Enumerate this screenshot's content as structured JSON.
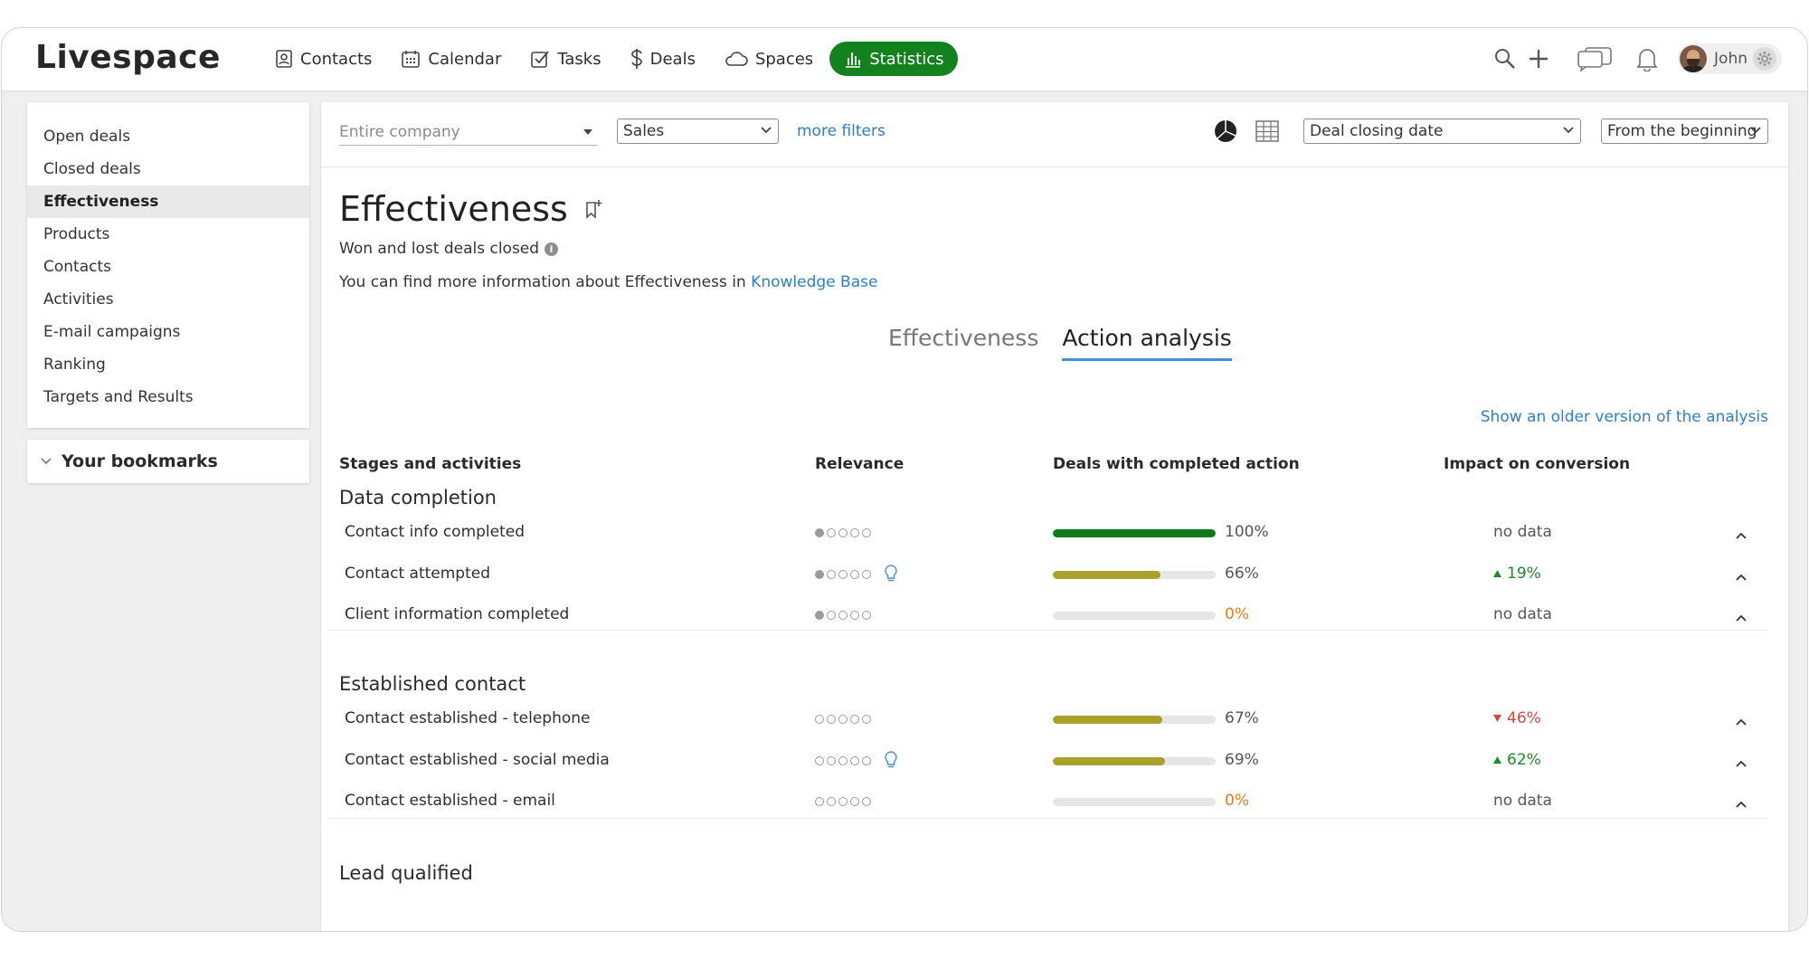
{
  "app": {
    "logo": "Livespace"
  },
  "nav": [
    {
      "label": "Contacts",
      "icon": "contacts-icon"
    },
    {
      "label": "Calendar",
      "icon": "calendar-icon"
    },
    {
      "label": "Tasks",
      "icon": "tasks-icon"
    },
    {
      "label": "Deals",
      "icon": "dollar-icon"
    },
    {
      "label": "Spaces",
      "icon": "cloud-icon"
    },
    {
      "label": "Statistics",
      "icon": "bar-chart-icon",
      "active": true
    }
  ],
  "user": {
    "name": "John"
  },
  "sidebar": {
    "items": [
      {
        "label": "Open deals"
      },
      {
        "label": "Closed deals"
      },
      {
        "label": "Effectiveness",
        "active": true
      },
      {
        "label": "Products"
      },
      {
        "label": "Contacts"
      },
      {
        "label": "Activities"
      },
      {
        "label": "E-mail campaigns"
      },
      {
        "label": "Ranking"
      },
      {
        "label": "Targets and Results"
      }
    ],
    "bookmarks_label": "Your bookmarks"
  },
  "filters": {
    "scope": "Entire company",
    "pipeline": "Sales",
    "more_filters": "more filters",
    "date_field": "Deal closing date",
    "period": "From the beginning"
  },
  "page": {
    "title": "Effectiveness",
    "subtitle": "Won and lost deals closed",
    "info_prefix": "You can find more information about Effectiveness in ",
    "info_link": "Knowledge Base",
    "tabs": [
      {
        "label": "Effectiveness",
        "active": false
      },
      {
        "label": "Action analysis",
        "active": true
      }
    ],
    "older_version": "Show an older version of the analysis"
  },
  "table": {
    "headers": {
      "stages": "Stages and activities",
      "relevance": "Relevance",
      "deals": "Deals with completed action",
      "impact": "Impact on conversion"
    },
    "groups": [
      {
        "title": "Data completion",
        "rows": [
          {
            "name": "Contact info completed",
            "relevance": 1,
            "tip": false,
            "pct": 100,
            "pct_label": "100%",
            "impact": "no data",
            "impact_dir": "none"
          },
          {
            "name": "Contact attempted",
            "relevance": 1,
            "tip": true,
            "pct": 66,
            "pct_label": "66%",
            "impact": "19%",
            "impact_dir": "up"
          },
          {
            "name": "Client information completed",
            "relevance": 1,
            "tip": false,
            "pct": 0,
            "pct_label": "0%",
            "impact": "no data",
            "impact_dir": "none"
          }
        ]
      },
      {
        "title": "Established contact",
        "rows": [
          {
            "name": "Contact established - telephone",
            "relevance": 0,
            "tip": false,
            "pct": 67,
            "pct_label": "67%",
            "impact": "46%",
            "impact_dir": "down"
          },
          {
            "name": "Contact established - social media",
            "relevance": 0,
            "tip": true,
            "pct": 69,
            "pct_label": "69%",
            "impact": "62%",
            "impact_dir": "up"
          },
          {
            "name": "Contact established - email",
            "relevance": 0,
            "tip": false,
            "pct": 0,
            "pct_label": "0%",
            "impact": "no data",
            "impact_dir": "none"
          }
        ]
      },
      {
        "title": "Lead qualified",
        "rows": []
      }
    ]
  },
  "colors": {
    "brand_green": "#13811d",
    "bar_full": "#0f7a1a",
    "bar_partial": "#a9a12c",
    "link": "#2f7fc4",
    "zero": "#e67a1e",
    "up": "#1d8a2b",
    "down": "#d9453a"
  }
}
